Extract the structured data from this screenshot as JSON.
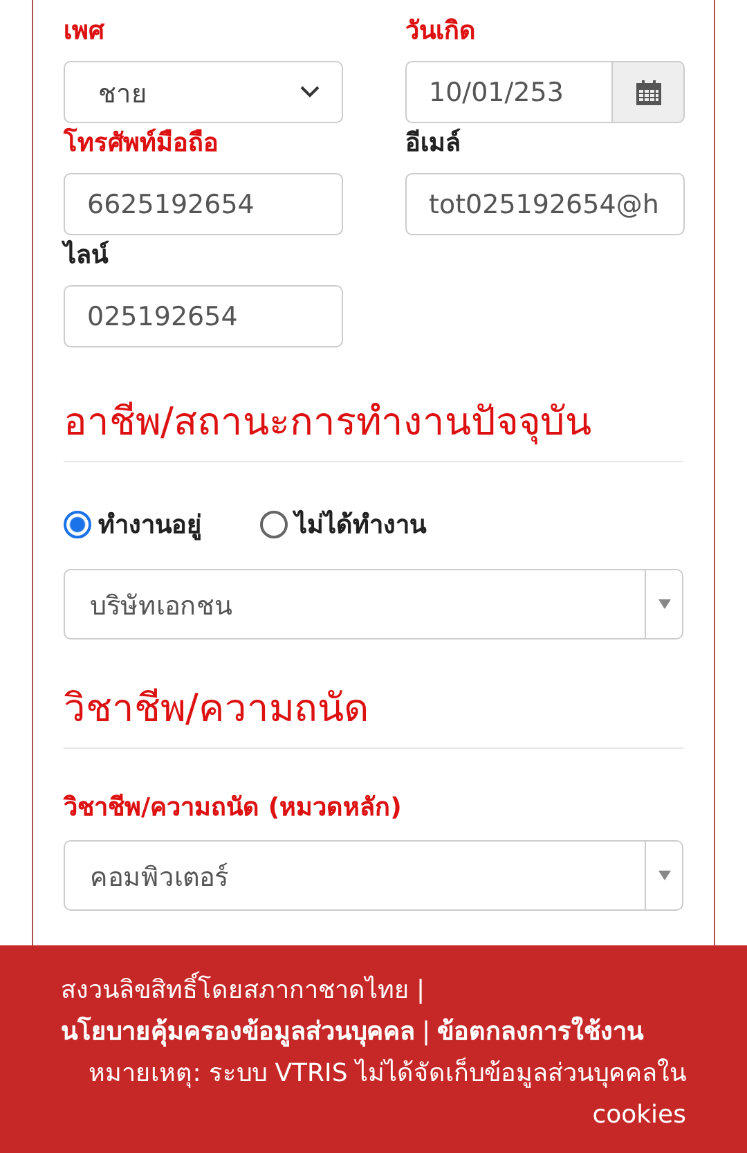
{
  "fields": [
    {
      "label": "เพศ",
      "required": true,
      "kind": "select",
      "value": "ชาย"
    },
    {
      "label": "วันเกิด",
      "required": true,
      "kind": "date",
      "value": "10/01/253"
    },
    {
      "label": "โทรศัพท์มือถือ",
      "required": true,
      "kind": "text",
      "value": "6625192654"
    },
    {
      "label": "อีเมล์",
      "required": false,
      "kind": "text",
      "value": "tot025192654@h"
    },
    {
      "label": "ไลน์",
      "required": false,
      "kind": "text",
      "value": "025192654"
    }
  ],
  "employment": {
    "title": "อาชีพ/สถานะการทำงานปัจจุบัน",
    "options": [
      {
        "label": "ทำงานอยู่",
        "selected": true
      },
      {
        "label": "ไม่ได้ทำงาน",
        "selected": false
      }
    ],
    "type_select": {
      "value": "บริษัทเอกชน"
    }
  },
  "occupation": {
    "title": "วิชาชีพ/ความถนัด",
    "label": "วิชาชีพ/ความถนัด (หมวดหลัก)",
    "required": true,
    "select": {
      "value": "คอมพิวเตอร์"
    }
  },
  "footer": {
    "copyright": "สงวนลิขสิทธิ์โดยสภากาชาดไทย",
    "separator": "|",
    "links": [
      "นโยบายคุ้มครองข้อมูลส่วนบุคคล",
      "ข้อตกลงการใช้งาน"
    ],
    "note": "หมายเหตุ: ระบบ VTRIS ไม่ได้จัดเก็บข้อมูลส่วนบุคคลใน cookies"
  }
}
